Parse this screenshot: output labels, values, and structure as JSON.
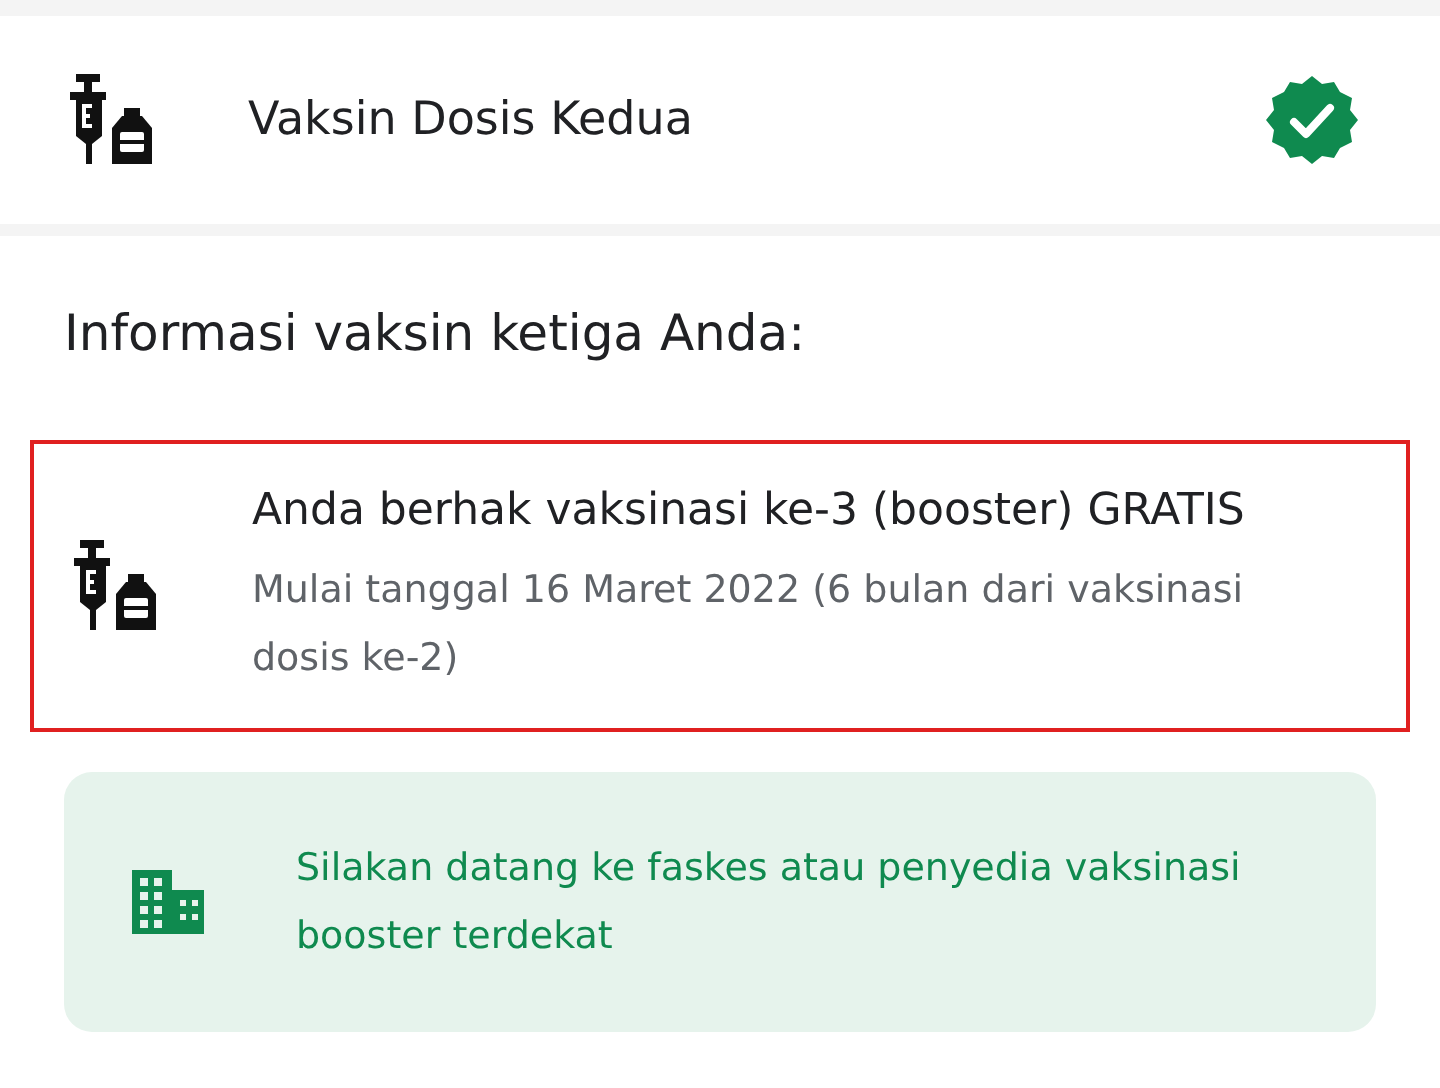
{
  "dose_row": {
    "title": "Vaksin Dosis Kedua",
    "completed": true
  },
  "section_heading": "Informasi vaksin ketiga Anda:",
  "eligibility_card": {
    "title": "Anda berhak vaksinasi ke-3 (booster) GRATIS",
    "subtitle": "Mulai tanggal 16 Maret 2022 (6 bulan dari vaksinasi dosis ke-2)",
    "highlighted": true
  },
  "info_box": {
    "text": "Silakan datang ke faskes atau penyedia vaksinasi booster terdekat"
  }
}
